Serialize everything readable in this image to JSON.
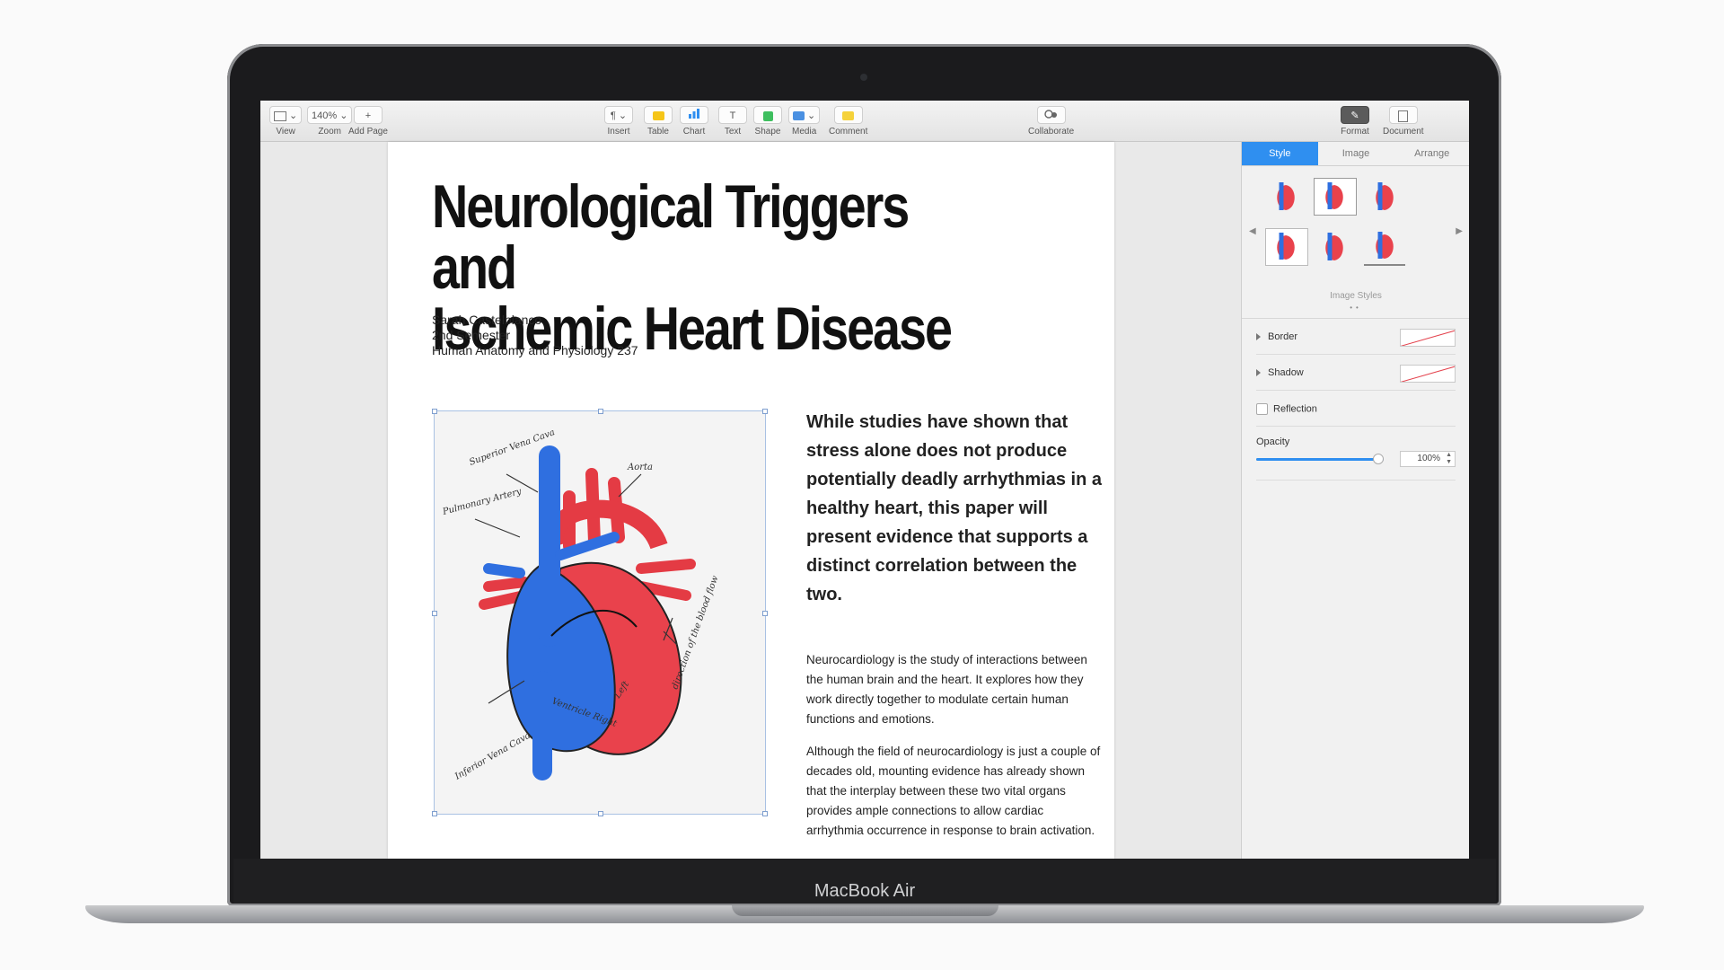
{
  "device": {
    "brand": "MacBook Air"
  },
  "toolbar": {
    "view": {
      "label": "View"
    },
    "zoom": {
      "label": "Zoom",
      "value": "140%"
    },
    "add_page": {
      "label": "Add Page",
      "glyph": "+"
    },
    "insert": {
      "label": "Insert",
      "glyph": "¶"
    },
    "table": {
      "label": "Table"
    },
    "chart": {
      "label": "Chart"
    },
    "text": {
      "label": "Text",
      "glyph": "T"
    },
    "shape": {
      "label": "Shape"
    },
    "media": {
      "label": "Media"
    },
    "comment": {
      "label": "Comment"
    },
    "collaborate": {
      "label": "Collaborate"
    },
    "format": {
      "label": "Format"
    },
    "document": {
      "label": "Document"
    },
    "colors": {
      "table": "#f5c518",
      "chart": "#2f8ff0",
      "shape": "#3fbf5f",
      "media": "#4a90e2",
      "comment": "#f5d23a"
    }
  },
  "document": {
    "title_line1": "Neurological Triggers and",
    "title_line2": "Ischemic Heart Disease",
    "author": "Sarah Castelblanco",
    "semester": "2nd Semester",
    "course": "Human Anatomy and Physiology 237",
    "pullquote": "While studies have shown that stress alone does not produce potentially deadly arrhythmias in a healthy heart, this paper will present evidence that supports a distinct correlation between the two.",
    "para1": "Neurocardiology is the study of interactions between the human brain and the heart. It explores how they work directly together to modulate certain human functions and emotions.",
    "para2": "Although the field of neurocardiology is just a couple of decades old, mounting evidence has already shown that the interplay between these two vital organs provides ample connections to allow cardiac arrhythmia occurrence in response to brain activation.",
    "figure": {
      "labels": [
        "Superior Vena Cava",
        "Aorta",
        "Pulmonary Artery",
        "Ventricle Right",
        "Left",
        "direction of the blood flow",
        "Inferior Vena Cava"
      ]
    }
  },
  "inspector": {
    "tabs": [
      "Style",
      "Image",
      "Arrange"
    ],
    "image_styles_label": "Image Styles",
    "border_label": "Border",
    "shadow_label": "Shadow",
    "reflection_label": "Reflection",
    "opacity_label": "Opacity",
    "opacity_value": "100%",
    "opacity_level": 1.0,
    "accent": "#2f8ff0"
  }
}
